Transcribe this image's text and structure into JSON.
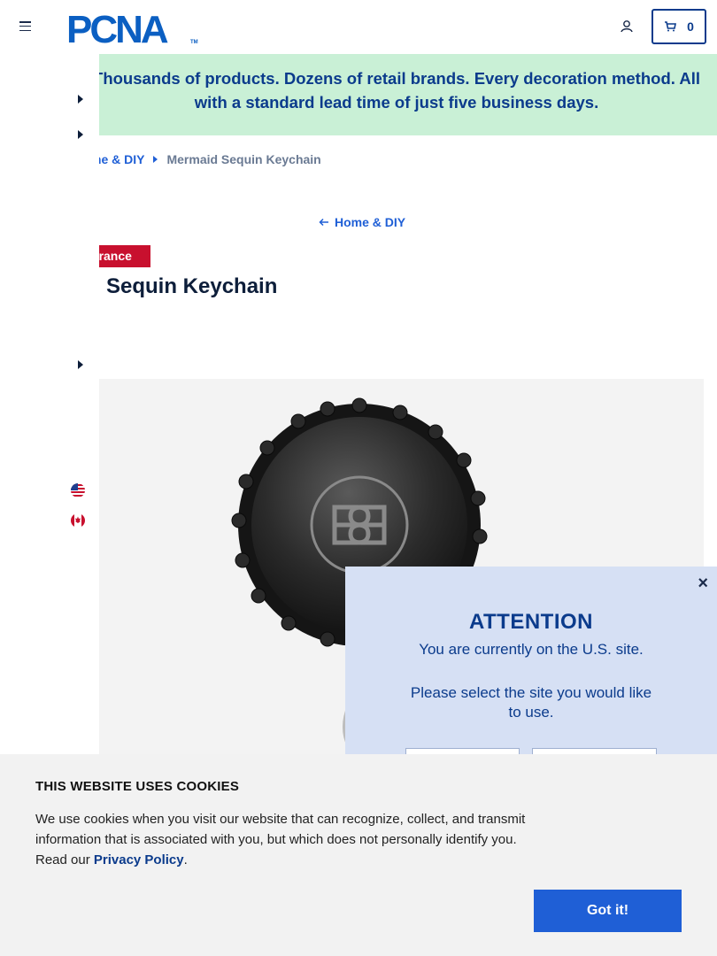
{
  "header": {
    "logo_text": "PCNA",
    "cart_count": "0"
  },
  "promo": {
    "text": "Thousands of products. Dozens of retail brands. Every decoration method. All with a standard lead time of just five business days."
  },
  "breadcrumb": {
    "parent": "me & DIY",
    "current": "Mermaid Sequin Keychain"
  },
  "back_link": "Home & DIY",
  "product": {
    "badge": "earance",
    "title": "Sequin Keychain"
  },
  "modal": {
    "title": "ATTENTION",
    "line1": "You are currently on the U.S. site.",
    "line2": "Please select the site you would like to use.",
    "close": "×"
  },
  "cookie": {
    "title": "THIS WEBSITE USES COOKIES",
    "text": "We use cookies when you visit our website that can recognize, collect, and transmit information that is associated with you, but which does not personally identify you. Read our ",
    "link": "Privacy Policy",
    "end": ".",
    "button": "Got it!"
  },
  "colors": {
    "brand_blue": "#0b3b8c",
    "link_blue": "#1f5fd6",
    "promo_bg": "#c9f0d6",
    "clearance_red": "#c8102e",
    "modal_bg": "#d6e0f4"
  }
}
